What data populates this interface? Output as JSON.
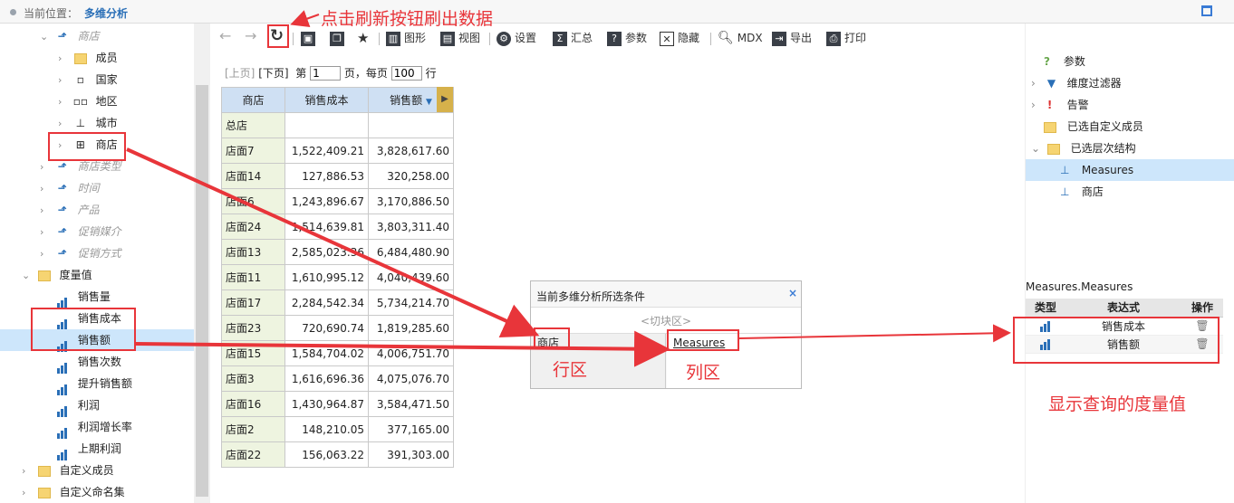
{
  "topbar": {
    "location_label": "当前位置：",
    "location_value": "多维分析"
  },
  "tree": {
    "shop_dim": "商店",
    "shop_children": [
      "成员",
      "国家",
      "地区",
      "城市",
      "商店"
    ],
    "other_dims": [
      "商店类型",
      "时间",
      "产品",
      "促销媒介",
      "促销方式"
    ],
    "measures_folder": "度量值",
    "measures": [
      "销售量",
      "销售成本",
      "销售额",
      "销售次数",
      "提升销售额",
      "利润",
      "利润增长率",
      "上期利润"
    ],
    "custom_members": "自定义成员",
    "custom_named_sets": "自定义命名集"
  },
  "toolbar": {
    "chart": "图形",
    "view": "视图",
    "settings": "设置",
    "summary": "汇总",
    "params": "参数",
    "hide": "隐藏",
    "mdx": "MDX",
    "export": "导出",
    "print": "打印"
  },
  "paging": {
    "prev": "[上页]",
    "next": "[下页]",
    "page_prefix": "第",
    "page_value": "1",
    "page_suffix": "页，每页",
    "size_value": "100",
    "size_suffix": "行"
  },
  "grid": {
    "headers": [
      "商店",
      "销售成本",
      "销售额"
    ],
    "rows": [
      [
        "总店",
        "",
        ""
      ],
      [
        "店面7",
        "1,522,409.21",
        "3,828,617.60"
      ],
      [
        "店面14",
        "127,886.53",
        "320,258.00"
      ],
      [
        "店面6",
        "1,243,896.67",
        "3,170,886.50"
      ],
      [
        "店面24",
        "1,514,639.81",
        "3,803,311.40"
      ],
      [
        "店面13",
        "2,585,023.36",
        "6,484,480.90"
      ],
      [
        "店面11",
        "1,610,995.12",
        "4,040,439.60"
      ],
      [
        "店面17",
        "2,284,542.34",
        "5,734,214.70"
      ],
      [
        "店面23",
        "720,690.74",
        "1,819,285.60"
      ],
      [
        "店面15",
        "1,584,704.02",
        "4,006,751.70"
      ],
      [
        "店面3",
        "1,616,696.36",
        "4,075,076.70"
      ],
      [
        "店面16",
        "1,430,964.87",
        "3,584,471.50"
      ],
      [
        "店面2",
        "148,210.05",
        "377,165.00"
      ],
      [
        "店面22",
        "156,063.22",
        "391,303.00"
      ]
    ]
  },
  "conditions": {
    "title": "当前多维分析所选条件",
    "slice": "<切块区>",
    "row_item": "商店",
    "col_item": "Measures"
  },
  "right": {
    "items": [
      "参数",
      "维度过滤器",
      "告警",
      "已选自定义成员",
      "已选层次结构"
    ],
    "hierarchy_children": [
      "Measures",
      "商店"
    ],
    "measures_title": "Measures.Measures",
    "table_headers": [
      "类型",
      "表达式",
      "操作"
    ],
    "table_rows": [
      "销售成本",
      "销售额"
    ]
  },
  "annotations": {
    "refresh_note": "点击刷新按钮刷出数据",
    "row_zone": "行区",
    "col_zone": "列区",
    "measures_note": "显示查询的度量值"
  },
  "colors": {
    "accent": "#2a6fb7",
    "annotation": "#e8353a",
    "header_bg": "#cfe0f3",
    "selected_bg": "#cde6fb"
  }
}
